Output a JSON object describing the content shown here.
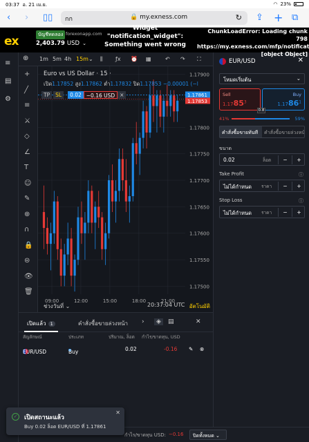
{
  "status_bar": {
    "time": "03:37",
    "date": "อ. 21 เม.ย.",
    "battery": "23%"
  },
  "browser": {
    "aa": "กก",
    "url": "my.exness.com"
  },
  "account": {
    "logo": "ex",
    "type": "บัญชีทดลอง",
    "source": "forexonapp.com",
    "balance": "2,403.79",
    "currency": "USD"
  },
  "errors": {
    "widget": "Widget \"notification_widget\": Something went wrong",
    "chunk": "ChunkLoadError: Loading chunk 798 https://my.exness.com/mfp/notification_widget [object Object]"
  },
  "chart_toolbar": {
    "plus": "⊕",
    "tf_1m": "1m",
    "tf_5m": "5m",
    "tf_4h": "4h",
    "tf_active": "15m",
    "chev": "⌄"
  },
  "chart": {
    "title": "Euro vs US Dollar · 15 ·",
    "ohlc": {
      "o_lbl": "เปิด",
      "o": "1.17852",
      "h_lbl": "สูง",
      "h": "1.17862",
      "l_lbl": "ต่ำ",
      "l": "1.17832",
      "c_lbl": "ปิด",
      "c": "1.17853",
      "chg": "−0.00001 (−l"
    },
    "position_line": {
      "tp": "TP",
      "sl": "SL",
      "lots": "0.02",
      "pnl": "−0.16 USD",
      "close": "×"
    },
    "price_labels": {
      "ask": "1.17861",
      "bid": "1.17853"
    },
    "footer": {
      "range": "ช่วงวันที่",
      "clock": "20:37:04 UTC",
      "auto": "อัตโนมัติ"
    }
  },
  "chart_data": {
    "type": "candlestick",
    "title": "Euro vs US Dollar · 15",
    "x_ticks": [
      "09:00",
      "12:00",
      "15:00",
      "18:00",
      "21:00"
    ],
    "y_ticks": [
      1.179,
      1.1785,
      1.178,
      1.1775,
      1.177,
      1.1765,
      1.176,
      1.1755,
      1.175
    ],
    "ylim": [
      1.17485,
      1.17915
    ],
    "candles": [
      [
        1.1764,
        1.1769,
        1.1757,
        1.1761
      ],
      [
        1.1761,
        1.1763,
        1.1756,
        1.1758
      ],
      [
        1.1758,
        1.1762,
        1.1753,
        1.176
      ],
      [
        1.176,
        1.1768,
        1.1758,
        1.1766
      ],
      [
        1.1766,
        1.1767,
        1.1755,
        1.1757
      ],
      [
        1.1757,
        1.1759,
        1.175,
        1.1752
      ],
      [
        1.1752,
        1.1758,
        1.175,
        1.1756
      ],
      [
        1.1756,
        1.1762,
        1.1754,
        1.1759
      ],
      [
        1.1759,
        1.1761,
        1.175,
        1.1752
      ],
      [
        1.1752,
        1.1756,
        1.1749,
        1.1755
      ],
      [
        1.1755,
        1.1765,
        1.1754,
        1.1763
      ],
      [
        1.1763,
        1.1766,
        1.1758,
        1.176
      ],
      [
        1.176,
        1.1764,
        1.1755,
        1.1762
      ],
      [
        1.1762,
        1.177,
        1.176,
        1.1768
      ],
      [
        1.1768,
        1.1769,
        1.176,
        1.1762
      ],
      [
        1.1762,
        1.1766,
        1.1757,
        1.1765
      ],
      [
        1.1765,
        1.1768,
        1.1761,
        1.1763
      ],
      [
        1.1763,
        1.1764,
        1.1755,
        1.1757
      ],
      [
        1.1757,
        1.1762,
        1.1754,
        1.176
      ],
      [
        1.176,
        1.1771,
        1.1759,
        1.177
      ],
      [
        1.177,
        1.1773,
        1.1764,
        1.1766
      ],
      [
        1.1766,
        1.177,
        1.1762,
        1.1768
      ],
      [
        1.1768,
        1.1776,
        1.1766,
        1.1774
      ],
      [
        1.1774,
        1.1776,
        1.1768,
        1.177
      ],
      [
        1.177,
        1.1774,
        1.1764,
        1.1766
      ],
      [
        1.1766,
        1.1769,
        1.1762,
        1.1767
      ],
      [
        1.1767,
        1.1778,
        1.1766,
        1.1777
      ],
      [
        1.1777,
        1.1781,
        1.1773,
        1.1775
      ],
      [
        1.1775,
        1.1779,
        1.1771,
        1.1778
      ],
      [
        1.1778,
        1.1785,
        1.1776,
        1.1783
      ],
      [
        1.1783,
        1.1784,
        1.1776,
        1.1779
      ],
      [
        1.1779,
        1.1788,
        1.1778,
        1.1786
      ],
      [
        1.1786,
        1.1789,
        1.1781,
        1.1784
      ],
      [
        1.1784,
        1.1787,
        1.1779,
        1.1786
      ],
      [
        1.1786,
        1.1787,
        1.178,
        1.1782
      ],
      [
        1.1782,
        1.1786,
        1.1779,
        1.1785
      ],
      [
        1.1785,
        1.1788,
        1.1782,
        1.1784
      ],
      [
        1.1784,
        1.1787,
        1.1782,
        1.1786
      ],
      [
        1.1786,
        1.1787,
        1.1781,
        1.1783
      ],
      [
        1.1783,
        1.1786,
        1.1781,
        1.1785
      ]
    ],
    "up_color": "#1e88e5",
    "down_color": "#e53935",
    "grid": true
  },
  "left_toolbar": {
    "icons": [
      "≡",
      "▤",
      "⚙"
    ]
  },
  "draw_tools": [
    "+",
    "╱",
    "≡",
    "⚔",
    "◇",
    "∠",
    "T",
    "☺",
    "✎",
    "⊕",
    "∩",
    "🔒",
    "⊜",
    "👁",
    "🗑"
  ],
  "order_panel": {
    "symbol": "EUR/USD",
    "mode": "โหมดเริ่มต้น",
    "sell": {
      "label": "Sell",
      "prefix": "1.17",
      "big": "85",
      "sup": "3"
    },
    "buy": {
      "label": "Buy",
      "prefix": "1.17",
      "big": "86",
      "sup": "1"
    },
    "spread": "0.8",
    "sell_pct": "41%",
    "buy_pct": "59%",
    "tab_market": "คำสั่งซื้อขายทันที",
    "tab_pending": "คำสั่งซื้อขายล่วงหน้า",
    "volume_label": "ขนาด",
    "volume": "0.02",
    "volume_unit": "ล็อต",
    "tp_label": "Take Profit",
    "tp_value": "ไม่ได้กำหนด",
    "tp_unit": "ราคา",
    "sl_label": "Stop Loss",
    "sl_value": "ไม่ได้กำหนด",
    "sl_unit": "ราคา",
    "minus": "−",
    "plus": "+",
    "info": "ⓘ"
  },
  "positions": {
    "tab_open": "เปิดแล้ว",
    "open_count": "1",
    "tab_pending": "คำสั่งซื้อขายล่วงหน้า",
    "headers": {
      "symbol": "สัญลักษณ์",
      "type": "ประเภท",
      "volume": "ปริมาณ, ล็อต",
      "pnl": "กำไร/ขาดทุน, USD"
    },
    "rows": [
      {
        "symbol": "EUR/USD",
        "type": "Buy",
        "volume": "0.02",
        "pnl": "-0.16"
      }
    ]
  },
  "summary": {
    "label": "กำไร/ขาดทุน USD:",
    "value": "−0.16",
    "close_all": "ปิดทั้งหมด"
  },
  "toast": {
    "title": "เปิดสถานะแล้ว",
    "body": "Buy 0.02 ล็อต EUR/USD ที่ 1.17861"
  }
}
